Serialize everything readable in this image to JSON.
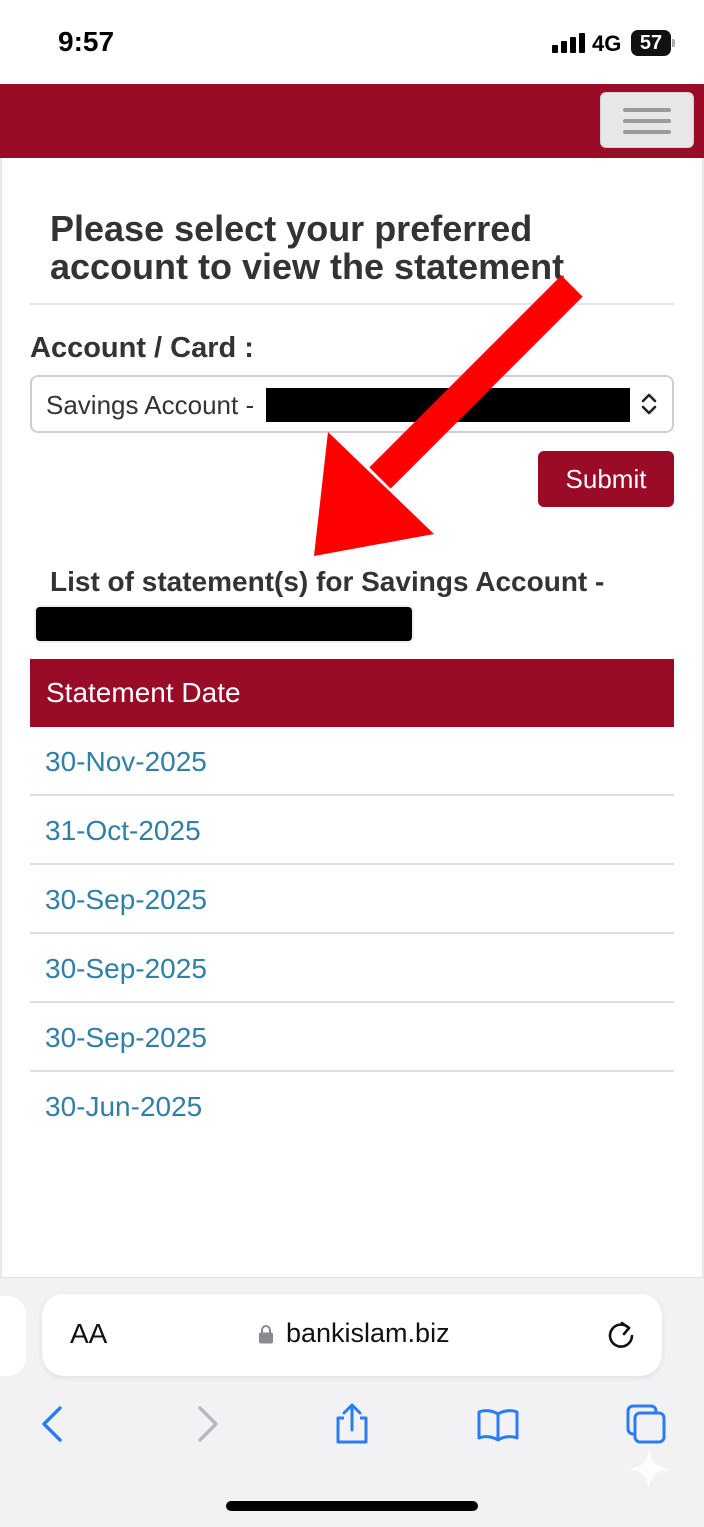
{
  "status_bar": {
    "time": "9:57",
    "network": "4G",
    "battery": "57"
  },
  "header": {
    "menu_icon": "hamburger-icon",
    "color": "#9a0b28"
  },
  "page": {
    "title": "Please select your preferred account to view the statement",
    "account_label": "Account / Card :",
    "account_select_value": "Savings Account -",
    "submit_label": "Submit",
    "list_heading": "List of statement(s) for Savings Account -",
    "table_header": "Statement Date",
    "statement_dates": [
      "30-Nov-2025",
      "31-Oct-2025",
      "30-Sep-2025",
      "30-Sep-2025",
      "30-Sep-2025",
      "30-Jun-2025"
    ],
    "link_color": "#2f7fa6"
  },
  "browser": {
    "text_size_button": "AA",
    "url": "bankislam.biz",
    "toolbar_icons": [
      "back-icon",
      "forward-icon",
      "share-icon",
      "bookmarks-icon",
      "tabs-icon"
    ]
  },
  "annotation": {
    "arrow_color": "#ff0000"
  }
}
